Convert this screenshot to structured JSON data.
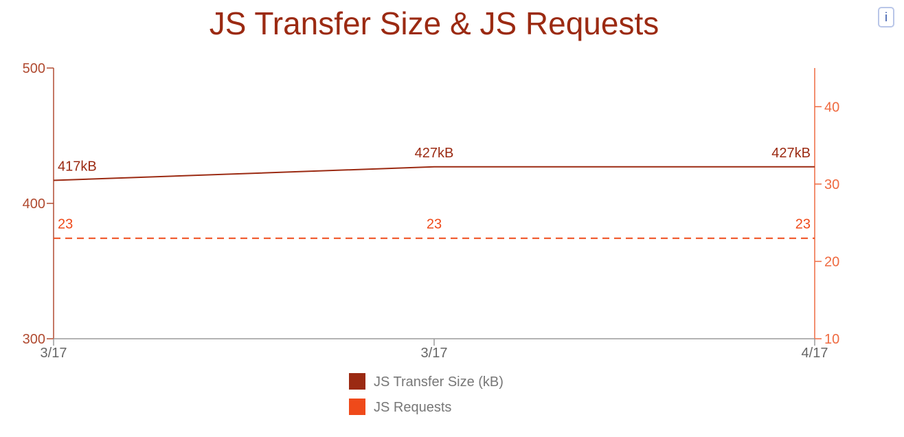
{
  "info_button": {
    "label": "i",
    "icon": "info-icon"
  },
  "chart_data": {
    "type": "line",
    "title": "JS Transfer Size & JS Requests",
    "categories": [
      "3/17",
      "3/17",
      "4/17"
    ],
    "y_left": {
      "lim": [
        300,
        500
      ],
      "ticks": [
        300,
        400,
        500
      ],
      "labels": [
        "300",
        "400",
        "500"
      ]
    },
    "y_right": {
      "lim": [
        10,
        45
      ],
      "ticks": [
        10,
        20,
        30,
        40
      ],
      "labels": [
        "10",
        "20",
        "30",
        "40"
      ]
    },
    "series": [
      {
        "name": "JS Transfer Size (kB)",
        "axis": "left",
        "style": "solid",
        "color": "#9b2a12",
        "values": [
          417,
          427,
          427
        ],
        "labels": [
          "417kB",
          "427kB",
          "427kB"
        ]
      },
      {
        "name": "JS Requests",
        "axis": "right",
        "style": "dashed",
        "color": "#ef4a1a",
        "values": [
          23,
          23,
          23
        ],
        "labels": [
          "23",
          "23",
          "23"
        ]
      }
    ],
    "legend": "bottom-center",
    "grid": false,
    "colors": {
      "title": "#9b2a12",
      "left_axis": "#b04a30",
      "right_axis": "#ef6a40",
      "x_axis": "#9a9a9a",
      "legend_text": "#777777"
    }
  }
}
